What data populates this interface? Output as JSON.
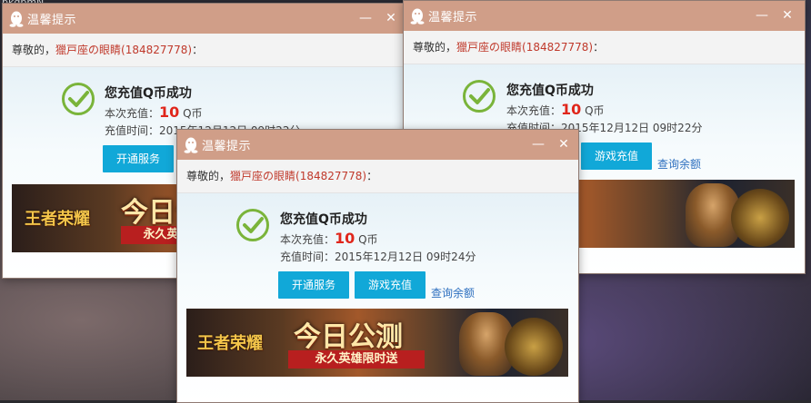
{
  "desktop": {
    "corner_text": "bkdbmN"
  },
  "window_common": {
    "title": "温馨提示",
    "greeting_prefix": "尊敬的，",
    "nickname": "獵戸座の眼睛(184827778)",
    "greeting_suffix": "：",
    "success_title": "您充值Q币成功",
    "amount_label": "本次充值：",
    "amount_value": "10",
    "amount_unit": " Q币",
    "time_label": "充值时间：",
    "btn_open_service": "开通服务",
    "btn_game_recharge": "游戏充值",
    "link_balance": "查询余额",
    "banner_logo": "王者荣耀",
    "banner_headline": "今日公测",
    "banner_ribbon": "永久英雄限时送",
    "minimize": "—",
    "close": "✕"
  },
  "windows": [
    {
      "id": "left",
      "time_value": "2015年12月12日 09时22分"
    },
    {
      "id": "right",
      "time_value": "2015年12月12日 09时22分"
    },
    {
      "id": "front",
      "time_value": "2015年12月12日 09时24分"
    }
  ],
  "colors": {
    "titlebar": "#d09e88",
    "button": "#11a8d8",
    "nickname": "#c0392b",
    "amount": "#e0261b",
    "check": "#7ab43a"
  }
}
